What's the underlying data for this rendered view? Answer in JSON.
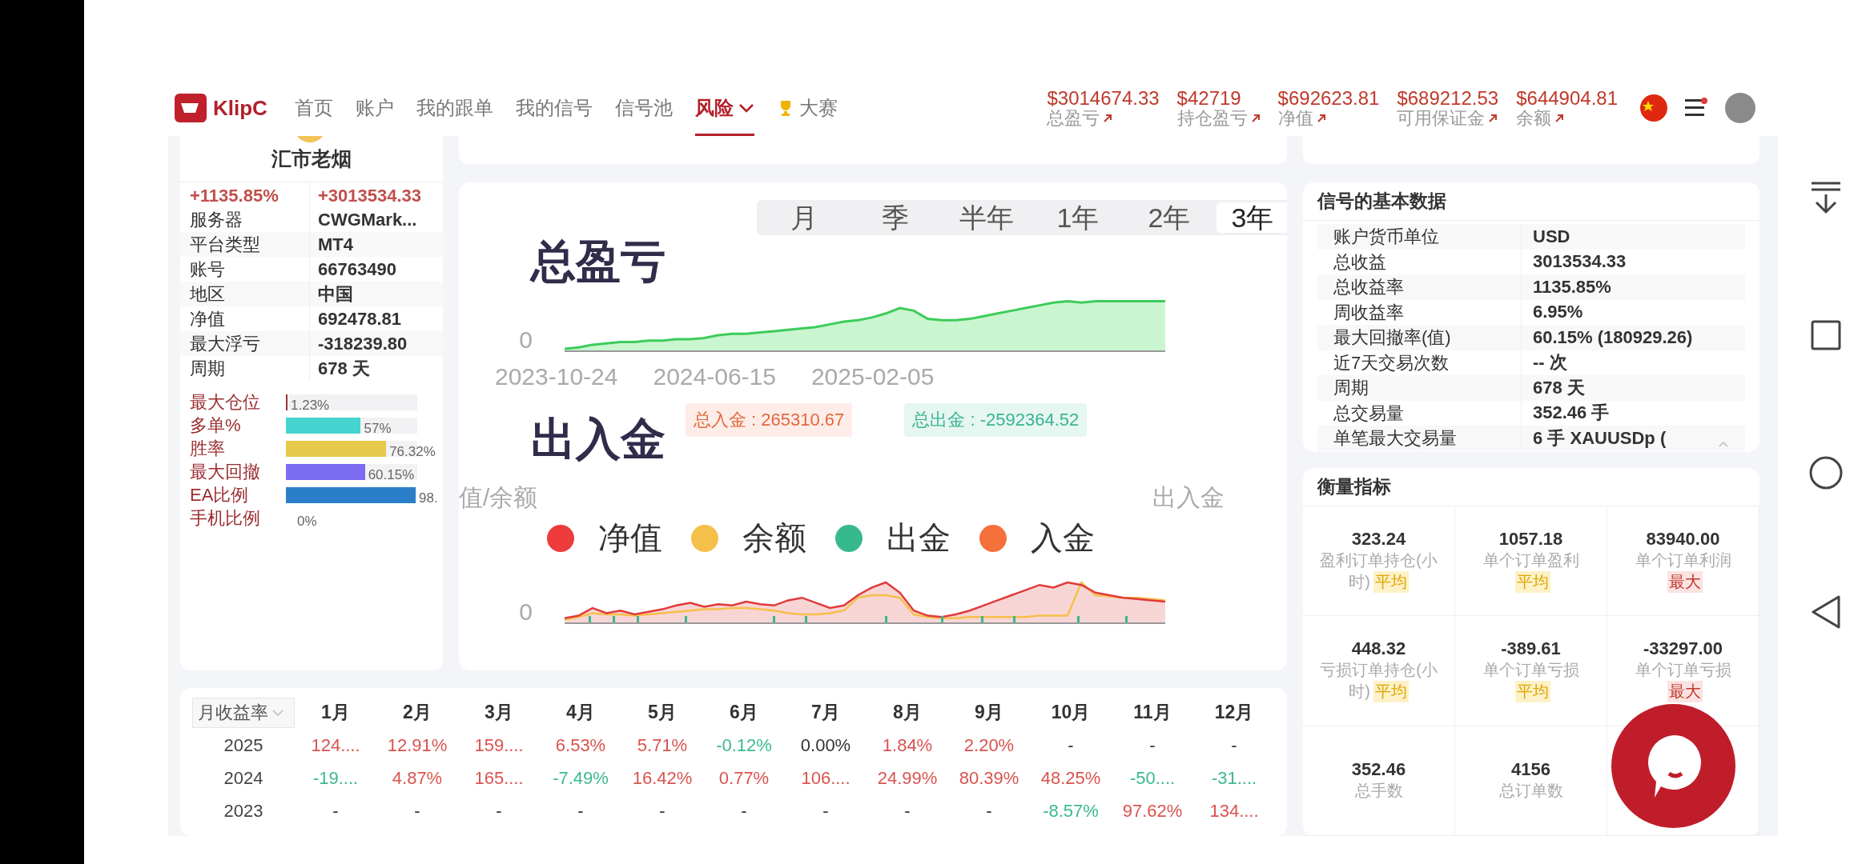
{
  "nav": {
    "logo": "KlipC",
    "items": [
      {
        "label": "首页",
        "selected": false,
        "kind": "plain"
      },
      {
        "label": "账户",
        "selected": false,
        "kind": "plain"
      },
      {
        "label": "我的跟单",
        "selected": false,
        "kind": "plain"
      },
      {
        "label": "我的信号",
        "selected": false,
        "kind": "plain"
      },
      {
        "label": "信号池",
        "selected": false,
        "kind": "plain"
      },
      {
        "label": "风险",
        "selected": true,
        "kind": "dropdown"
      },
      {
        "label": "大赛",
        "selected": false,
        "kind": "trophy"
      }
    ],
    "stats": [
      {
        "value": "$3014674.33",
        "label": "总盈亏"
      },
      {
        "value": "$42719",
        "label": "持仓盈亏"
      },
      {
        "value": "$692623.81",
        "label": "净值"
      },
      {
        "value": "$689212.53",
        "label": "可用保证金"
      },
      {
        "value": "$644904.81",
        "label": "余额"
      }
    ]
  },
  "profile": {
    "name": "汇市老烟",
    "gain_percent": "+1135.85%",
    "gain_amount": "+3013534.33",
    "details": [
      {
        "label": "服务器",
        "value": "CWGMark..."
      },
      {
        "label": "平台类型",
        "value": "MT4"
      },
      {
        "label": "账号",
        "value": "66763490"
      },
      {
        "label": "地区",
        "value": "中国"
      },
      {
        "label": "净值",
        "value": "692478.81"
      },
      {
        "label": "最大浮亏",
        "value": "-318239.80"
      },
      {
        "label": "周期",
        "value": "678 天"
      }
    ],
    "bars": [
      {
        "label": "最大仓位",
        "level": 0.0123,
        "reading": "1.23%",
        "color": "#a0363c"
      },
      {
        "label": "多单%",
        "level": 0.57,
        "reading": "57%",
        "color": "#45d4d0"
      },
      {
        "label": "胜率",
        "level": 0.7632,
        "reading": "76.32%",
        "color": "#e6c84a"
      },
      {
        "label": "最大回撤",
        "level": 0.6015,
        "reading": "60.15%",
        "color": "#7b6cf0"
      },
      {
        "label": "EA比例",
        "level": 0.988,
        "reading": "98.",
        "color": "#2a7fc8"
      },
      {
        "label": "手机比例",
        "reading": "0%"
      }
    ]
  },
  "performance": {
    "periods": [
      {
        "label": "月",
        "selected": false
      },
      {
        "label": "季",
        "selected": false
      },
      {
        "label": "半年",
        "selected": false
      },
      {
        "label": "1年",
        "selected": false
      },
      {
        "label": "2年",
        "selected": false
      },
      {
        "label": "3年",
        "selected": true
      }
    ],
    "profit_title": "总盈亏",
    "profit_y_label": "0",
    "dates": [
      "2023-10-24",
      "2024-06-15",
      "2025-02-05"
    ],
    "funds_title": "出入金",
    "deposit_total": "总入金 : 265310.67",
    "withdraw_total": "总出金 : -2592364.52",
    "left_axis_title": "值/余额",
    "right_axis_title": "出入金",
    "funds_y_label": "0",
    "legend": [
      {
        "label": "净值",
        "color": "#ee3b3b"
      },
      {
        "label": "余额",
        "color": "#f5c04a"
      },
      {
        "label": "出金",
        "color": "#36b98f"
      },
      {
        "label": "入金",
        "color": "#f5703a"
      }
    ]
  },
  "basic_data": {
    "title": "信号的基本数据",
    "rows": [
      {
        "label": "账户货币单位",
        "value": "USD"
      },
      {
        "label": "总收益",
        "value": "3013534.33"
      },
      {
        "label": "总收益率",
        "value": "1135.85%"
      },
      {
        "label": "周收益率",
        "value": "6.95%"
      },
      {
        "label": "最大回撤率(值)",
        "value": "60.15% (180929.26)"
      },
      {
        "label": "近7天交易次数",
        "value": "-- 次"
      },
      {
        "label": "周期",
        "value": "678 天"
      },
      {
        "label": "总交易量",
        "value": "352.46 手"
      },
      {
        "label": "单笔最大交易量",
        "value": "6 手 XAUUSDp ("
      }
    ]
  },
  "metrics": {
    "title": "衡量指标",
    "cells": [
      {
        "value": "323.24",
        "label": "盈利订单持仓(小时)",
        "badge": {
          "text": "平均",
          "kind": "average"
        }
      },
      {
        "value": "1057.18",
        "label": "单个订单盈利",
        "badge": {
          "text": "平均",
          "kind": "average"
        }
      },
      {
        "value": "83940.00",
        "label": "单个订单利润",
        "badge": {
          "text": "最大",
          "kind": "max"
        }
      },
      {
        "value": "448.32",
        "label": "亏损订单持仓(小时)",
        "badge": {
          "text": "平均",
          "kind": "average"
        }
      },
      {
        "value": "-389.61",
        "label": "单个订单亏损",
        "badge": {
          "text": "平均",
          "kind": "average"
        }
      },
      {
        "value": "-33297.00",
        "label": "单个订单亏损",
        "badge": {
          "text": "最大",
          "kind": "max"
        }
      },
      {
        "value": "352.46",
        "label": "总手数"
      },
      {
        "value": "4156",
        "label": "总订单数"
      }
    ]
  },
  "monthly_returns": {
    "selector": "月收益率",
    "months": [
      "1月",
      "2月",
      "3月",
      "4月",
      "5月",
      "6月",
      "7月",
      "8月",
      "9月",
      "10月",
      "11月",
      "12月"
    ],
    "rows": [
      {
        "year": "2025",
        "cells": [
          {
            "text": "124....",
            "color": "#d9534f"
          },
          {
            "text": "12.91%",
            "color": "#d9534f"
          },
          {
            "text": "159....",
            "color": "#d9534f"
          },
          {
            "text": "6.53%",
            "color": "#d9534f"
          },
          {
            "text": "5.71%",
            "color": "#d9534f"
          },
          {
            "text": "-0.12%",
            "color": "#3cb98f"
          },
          {
            "text": "0.00%",
            "color": "#333333"
          },
          {
            "text": "1.84%",
            "color": "#d9534f"
          },
          {
            "text": "2.20%",
            "color": "#d9534f"
          },
          {
            "text": "-",
            "color": "#333333"
          },
          {
            "text": "-",
            "color": "#333333"
          },
          {
            "text": "-",
            "color": "#333333"
          }
        ]
      },
      {
        "year": "2024",
        "cells": [
          {
            "text": "-19....",
            "color": "#3cb98f"
          },
          {
            "text": "4.87%",
            "color": "#d9534f"
          },
          {
            "text": "165....",
            "color": "#d9534f"
          },
          {
            "text": "-7.49%",
            "color": "#3cb98f"
          },
          {
            "text": "16.42%",
            "color": "#d9534f"
          },
          {
            "text": "0.77%",
            "color": "#d9534f"
          },
          {
            "text": "106....",
            "color": "#d9534f"
          },
          {
            "text": "24.99%",
            "color": "#d9534f"
          },
          {
            "text": "80.39%",
            "color": "#d9534f"
          },
          {
            "text": "48.25%",
            "color": "#d9534f"
          },
          {
            "text": "-50....",
            "color": "#3cb98f"
          },
          {
            "text": "-31....",
            "color": "#3cb98f"
          }
        ]
      },
      {
        "year": "2023",
        "cells": [
          {
            "text": "-",
            "color": "#333333"
          },
          {
            "text": "-",
            "color": "#333333"
          },
          {
            "text": "-",
            "color": "#333333"
          },
          {
            "text": "-",
            "color": "#333333"
          },
          {
            "text": "-",
            "color": "#333333"
          },
          {
            "text": "-",
            "color": "#333333"
          },
          {
            "text": "-",
            "color": "#333333"
          },
          {
            "text": "-",
            "color": "#333333"
          },
          {
            "text": "-",
            "color": "#333333"
          },
          {
            "text": "-8.57%",
            "color": "#3cb98f"
          },
          {
            "text": "97.62%",
            "color": "#d9534f"
          },
          {
            "text": "134....",
            "color": "#d9534f"
          }
        ]
      }
    ]
  }
}
